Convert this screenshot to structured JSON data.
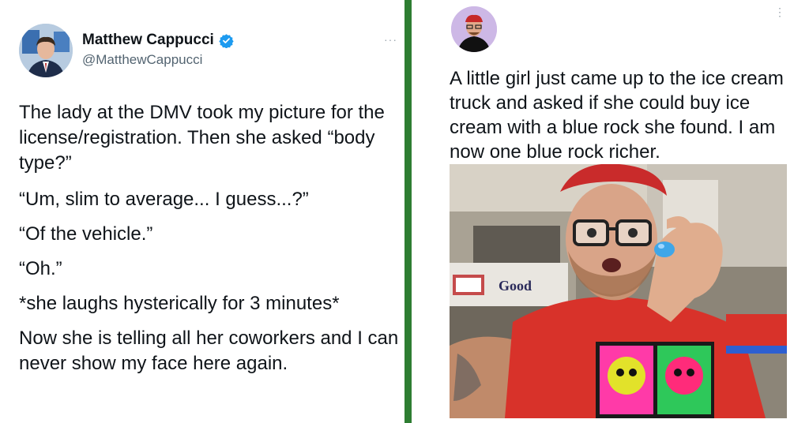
{
  "left_tweet": {
    "display_name": "Matthew Cappucci",
    "handle": "@MatthewCappucci",
    "more": "···",
    "paragraphs": [
      "The lady at the DMV took my picture for the license/registration. Then she asked “body type?”",
      "“Um, slim to average... I guess...?”",
      "“Of the vehicle.”",
      "“Oh.”",
      "*she laughs hysterically for 3 minutes*",
      "Now she is telling all her coworkers and I can never show my face here again."
    ]
  },
  "right_tweet": {
    "more": "⋮",
    "text": "A little girl just came up to the ice cream truck and asked if she could buy ice cream with a blue rock she found. I am now one blue rock richer.",
    "photo_sign_text": "Good"
  },
  "colors": {
    "divider": "#2e7d32",
    "verified": "#1d9bf0",
    "text": "#0f1419",
    "muted": "#536471"
  }
}
